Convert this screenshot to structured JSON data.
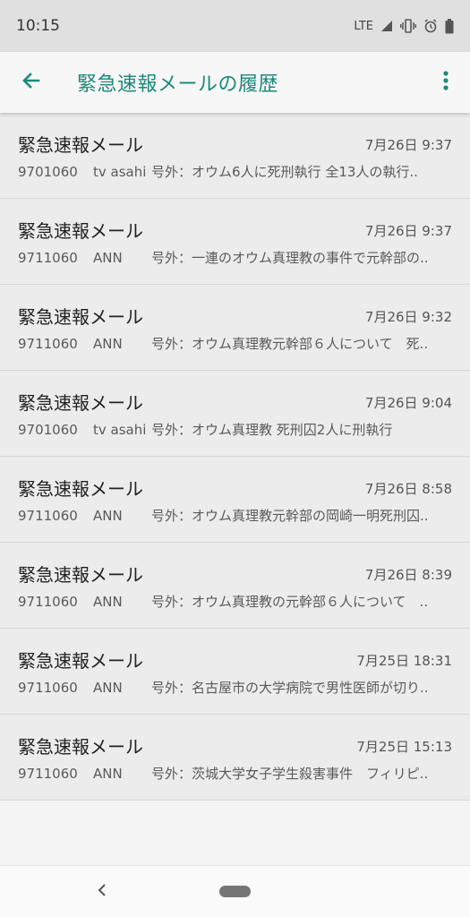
{
  "status_bar": {
    "time": "10:15",
    "network": "LTE",
    "icons": [
      "signal-icon",
      "vibrate-icon",
      "alarm-icon",
      "battery-icon"
    ]
  },
  "app_bar": {
    "title": "緊急速報メールの履歴",
    "accent_color": "#1b8a7a",
    "back_icon": "arrow-left-icon",
    "menu_icon": "more-vert-icon"
  },
  "messages": [
    {
      "title": "緊急速報メール",
      "time": "7月26日 9:37",
      "code": "9701060",
      "sender": "tv asahi",
      "text": "号外：オウム6人に死刑執行 全13人の執行.."
    },
    {
      "title": "緊急速報メール",
      "time": "7月26日 9:37",
      "code": "9711060",
      "sender": "ANN",
      "text": "号外：一連のオウム真理教の事件で元幹部の.."
    },
    {
      "title": "緊急速報メール",
      "time": "7月26日 9:32",
      "code": "9711060",
      "sender": "ANN",
      "text": "号外：オウム真理教元幹部６人について　死.."
    },
    {
      "title": "緊急速報メール",
      "time": "7月26日 9:04",
      "code": "9701060",
      "sender": "tv asahi",
      "text": "号外：オウム真理教 死刑囚2人に刑執行"
    },
    {
      "title": "緊急速報メール",
      "time": "7月26日 8:58",
      "code": "9711060",
      "sender": "ANN",
      "text": "号外：オウム真理教元幹部の岡崎一明死刑囚.."
    },
    {
      "title": "緊急速報メール",
      "time": "7月26日 8:39",
      "code": "9711060",
      "sender": "ANN",
      "text": "号外：オウム真理教の元幹部６人について　.."
    },
    {
      "title": "緊急速報メール",
      "time": "7月25日 18:31",
      "code": "9711060",
      "sender": "ANN",
      "text": "号外：名古屋市の大学病院で男性医師が切り.."
    },
    {
      "title": "緊急速報メール",
      "time": "7月25日 15:13",
      "code": "9711060",
      "sender": "ANN",
      "text": "号外：茨城大学女子学生殺害事件　フィリピ.."
    }
  ]
}
